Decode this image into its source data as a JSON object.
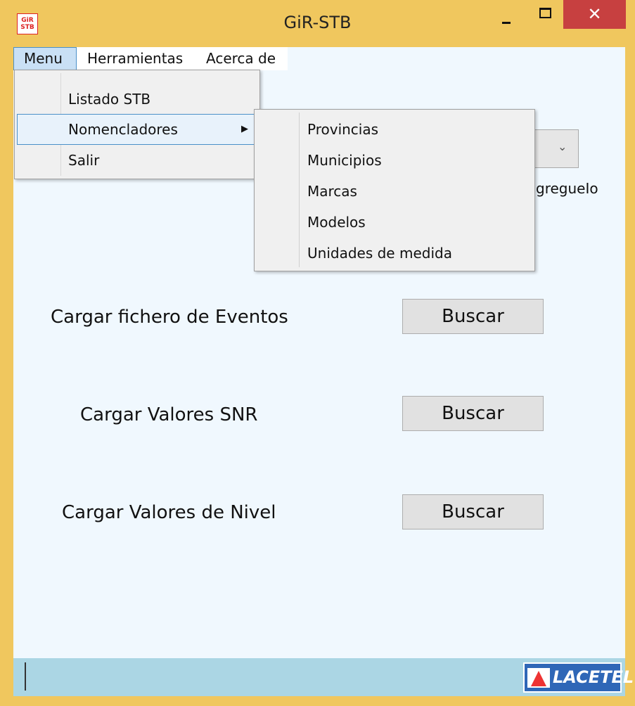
{
  "window": {
    "title": "GiR-STB",
    "icon_text": [
      "GiR",
      "STB"
    ],
    "close_glyph": "✕"
  },
  "menubar": {
    "items": [
      "Menu",
      "Herramientas",
      "Acerca de"
    ]
  },
  "dropdown_menu": {
    "items": [
      "Listado STB",
      "Nomencladores",
      "Salir"
    ],
    "submenu_arrow": "▶"
  },
  "submenu_nomencladores": {
    "items": [
      "Provincias",
      "Municipios",
      "Marcas",
      "Modelos",
      "Unidades de medida"
    ]
  },
  "partial_label": "gregueIo",
  "combo_chevron": "⌄",
  "rows": [
    {
      "label": "Cargar fichero de Eventos",
      "button": "Buscar"
    },
    {
      "label": "Cargar Valores SNR",
      "button": "Buscar"
    },
    {
      "label": "Cargar Valores de Nivel",
      "button": "Buscar"
    }
  ],
  "statusbar": {
    "logo_text": "LACETEL"
  },
  "colors": {
    "window_frame": "#f0c75e",
    "client_background": "#f0f8fe",
    "close_button": "#c74040",
    "statusbar": "#abd6e4",
    "menu_highlight": "#4a90c8",
    "logo_background": "#2f67b7"
  }
}
